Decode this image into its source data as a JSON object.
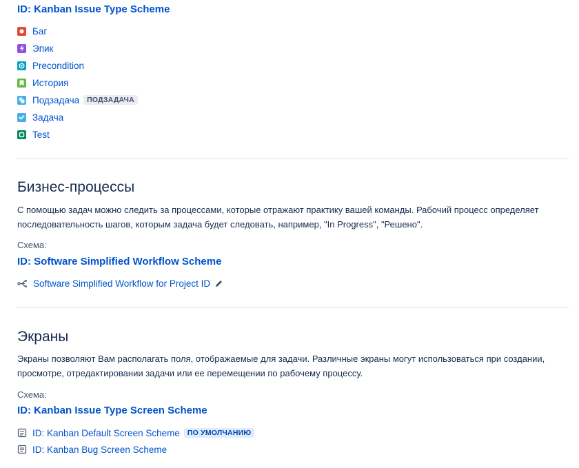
{
  "issue_types": {
    "scheme_title": "ID: Kanban Issue Type Scheme",
    "items": [
      {
        "label": "Баг",
        "icon": "bug-icon",
        "color": "#e5493a"
      },
      {
        "label": "Эпик",
        "icon": "epic-icon",
        "color": "#904ee2"
      },
      {
        "label": "Precondition",
        "icon": "precondition-icon",
        "color": "#00a3bf"
      },
      {
        "label": "История",
        "icon": "story-icon",
        "color": "#63ba3c"
      },
      {
        "label": "Подзадача",
        "icon": "subtask-icon",
        "color": "#4bade8",
        "badge": "ПОДЗАДАЧА"
      },
      {
        "label": "Задача",
        "icon": "task-icon",
        "color": "#4bade8"
      },
      {
        "label": "Test",
        "icon": "test-icon",
        "color": "#00875a"
      }
    ]
  },
  "workflows": {
    "heading": "Бизнес-процессы",
    "description": "С помощью задач можно следить за процессами, которые отражают практику вашей команды. Рабочий процесс определяет последовательность шагов, которым задача будет следовать, например, \"In Progress\", \"Решено\".",
    "scheme_label": "Схема:",
    "scheme_title": "ID: Software Simplified Workflow Scheme",
    "workflow_link": "Software Simplified Workflow for Project ID"
  },
  "screens": {
    "heading": "Экраны",
    "description": "Экраны позволяют Вам располагать поля, отображаемые для задачи. Различные экраны могут использоваться при создании, просмотре, отредактировании задачи или ее перемещении по рабочему процессу.",
    "scheme_label": "Схема:",
    "scheme_title": "ID: Kanban Issue Type Screen Scheme",
    "items": [
      {
        "label": "ID: Kanban Default Screen Scheme",
        "badge": "ПО УМОЛЧАНИЮ"
      },
      {
        "label": "ID: Kanban Bug Screen Scheme"
      }
    ]
  },
  "colors": {
    "link": "#0052cc",
    "text": "#172b4d",
    "divider": "#dfe1e6"
  }
}
